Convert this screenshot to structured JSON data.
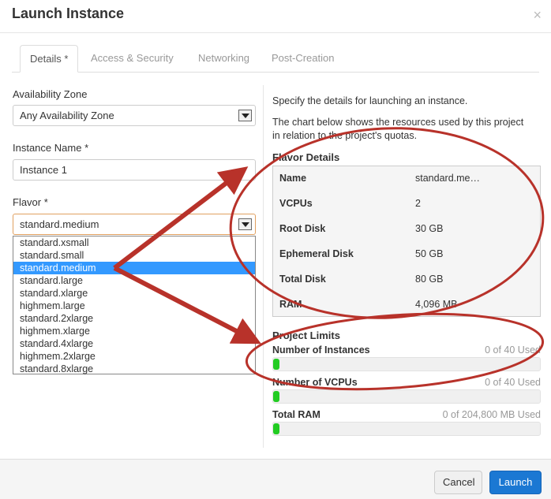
{
  "dialog": {
    "title": "Launch Instance",
    "close_glyph": "×"
  },
  "tabs": [
    {
      "label": "Details *"
    },
    {
      "label": "Access & Security"
    },
    {
      "label": "Networking"
    },
    {
      "label": "Post-Creation"
    }
  ],
  "form": {
    "availability_zone": {
      "label": "Availability Zone",
      "value": "Any Availability Zone"
    },
    "instance_name": {
      "label": "Instance Name",
      "required_mark": "*",
      "value": "Instance 1"
    },
    "flavor": {
      "label": "Flavor",
      "required_mark": "*",
      "value": "standard.medium",
      "options": [
        "standard.xsmall",
        "standard.small",
        "standard.medium",
        "standard.large",
        "standard.xlarge",
        "highmem.large",
        "standard.2xlarge",
        "highmem.xlarge",
        "standard.4xlarge",
        "highmem.2xlarge",
        "standard.8xlarge"
      ],
      "selected_index": 2
    }
  },
  "details": {
    "intro": "Specify the details for launching an instance.",
    "chart_note_line1": "The chart below shows the resources used by this project",
    "chart_note_line2": "in relation to the project's quotas.",
    "flavor_details_title": "Flavor Details",
    "flavor_rows": [
      {
        "key": "Name",
        "value": "standard.me…"
      },
      {
        "key": "VCPUs",
        "value": "2"
      },
      {
        "key": "Root Disk",
        "value": "30 GB"
      },
      {
        "key": "Ephemeral Disk",
        "value": "50 GB"
      },
      {
        "key": "Total Disk",
        "value": "80 GB"
      },
      {
        "key": "RAM",
        "value": "4,096 MB"
      }
    ],
    "project_limits_title": "Project Limits",
    "limits": [
      {
        "label": "Number of Instances",
        "used_text": "0 of 40 Used",
        "fraction": 0.02
      },
      {
        "label": "Number of VCPUs",
        "used_text": "0 of 40 Used",
        "fraction": 0.02
      },
      {
        "label": "Total RAM",
        "used_text": "0 of 204,800 MB Used",
        "fraction": 0.02
      }
    ]
  },
  "footer": {
    "cancel_label": "Cancel",
    "launch_label": "Launch"
  },
  "colors": {
    "primary": "#1b78d3",
    "progress": "#22cc22",
    "selected": "#3399ff",
    "annotation": "#b8322a"
  }
}
